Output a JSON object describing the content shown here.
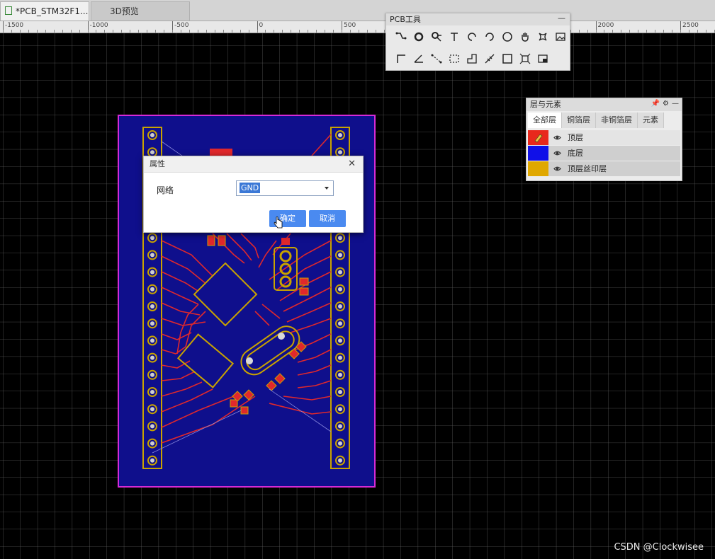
{
  "tabs": [
    {
      "label": "*PCB_STM32F1..."
    },
    {
      "label": "3D预览"
    }
  ],
  "ruler": {
    "labels": [
      "-1500",
      "-1000",
      "-500",
      "0",
      "500",
      "1000",
      "1500",
      "2000",
      "2500"
    ]
  },
  "pcb_tools": {
    "title": "PCB工具",
    "minimize": "—",
    "row1_icons": [
      "wire-icon",
      "via-icon",
      "pad-icon",
      "text-icon",
      "arc-icon",
      "arc-ccw-icon",
      "circle-icon",
      "pan-hand-icon",
      "shape-icon",
      "image-icon"
    ],
    "row2_icons": [
      "corner-icon",
      "angle-icon",
      "dimension-icon",
      "region-icon",
      "polygon-icon",
      "net-label-icon",
      "rectangle-icon",
      "align-icon",
      "copper-pour-icon"
    ]
  },
  "layers_panel": {
    "title": "层与元素",
    "tabs": [
      "全部层",
      "铜箔层",
      "非铜箔层",
      "元素"
    ],
    "rows": [
      {
        "name": "顶层",
        "color": "#e8281c"
      },
      {
        "name": "底层",
        "color": "#1010e8"
      },
      {
        "name": "顶层丝印层",
        "color": "#e0a800"
      }
    ]
  },
  "dialog": {
    "title": "属性",
    "close": "✕",
    "field_label": "网络",
    "field_value": "GND",
    "ok_label": "确定",
    "cancel_label": "取消"
  },
  "watermark": "CSDN @Clockwisee"
}
